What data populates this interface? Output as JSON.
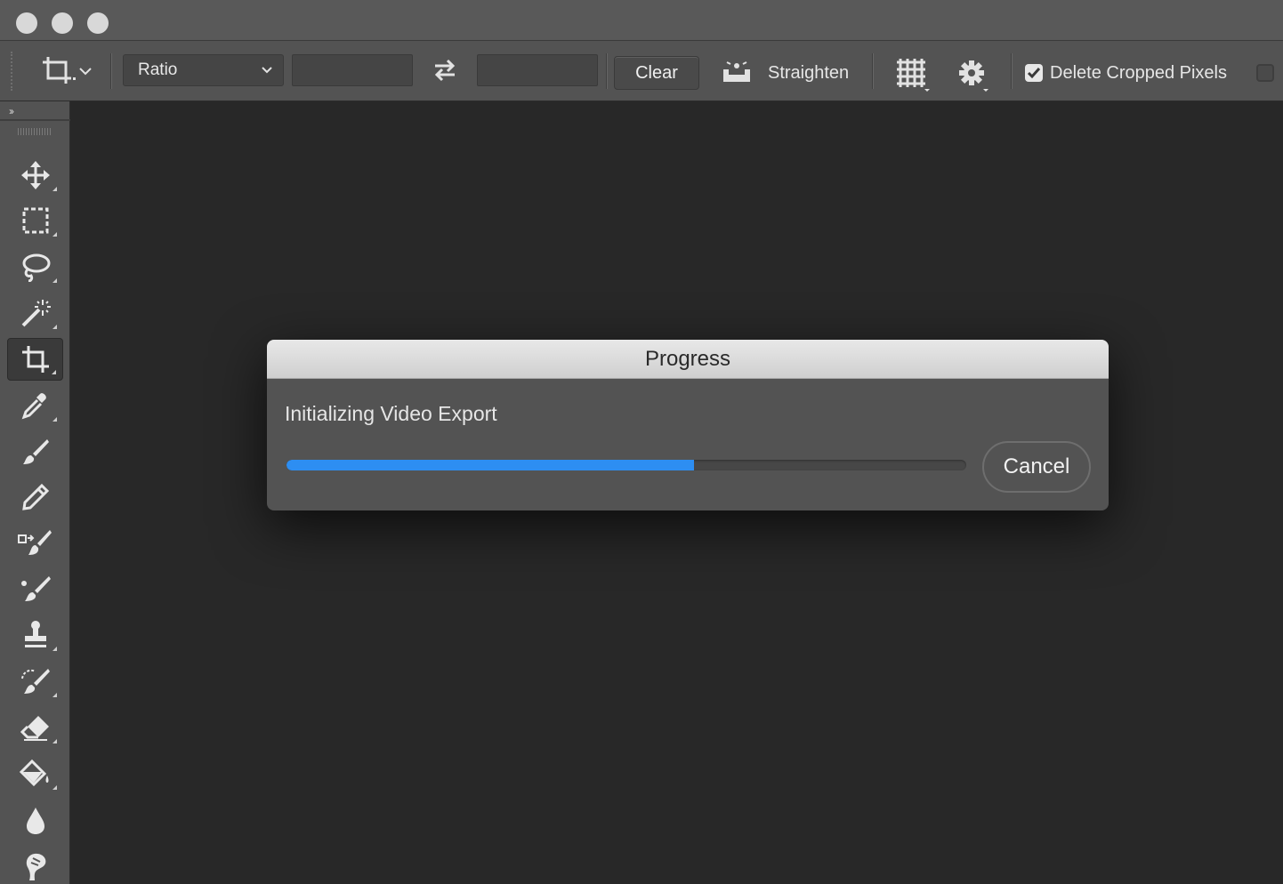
{
  "window": {
    "traffic_lights": [
      "close",
      "minimize",
      "zoom"
    ]
  },
  "options_bar": {
    "tool_icon": "crop-tool-icon",
    "ratio_select": {
      "selected": "Ratio"
    },
    "width_field": {
      "value": ""
    },
    "swap_icon": "swap-arrows-icon",
    "height_field": {
      "value": ""
    },
    "clear_label": "Clear",
    "straighten_label": "Straighten",
    "overlay_icon": "grid-overlay-icon",
    "settings_icon": "gear-icon",
    "delete_cropped": {
      "label": "Delete Cropped Pixels",
      "checked": true
    }
  },
  "toolbar": {
    "collapse_label": "››",
    "tools": [
      {
        "name": "move",
        "icon": "move-icon"
      },
      {
        "name": "marquee",
        "icon": "rectangular-marquee-icon"
      },
      {
        "name": "lasso",
        "icon": "lasso-icon"
      },
      {
        "name": "magic-wand",
        "icon": "magic-wand-icon"
      },
      {
        "name": "crop",
        "icon": "crop-icon",
        "active": true
      },
      {
        "name": "eyedropper",
        "icon": "eyedropper-icon"
      },
      {
        "name": "healing-brush",
        "icon": "healing-brush-icon"
      },
      {
        "name": "pencil",
        "icon": "pencil-icon"
      },
      {
        "name": "color-replacement",
        "icon": "color-replacement-icon"
      },
      {
        "name": "mixer-brush",
        "icon": "mixer-brush-icon"
      },
      {
        "name": "clone-stamp",
        "icon": "clone-stamp-icon"
      },
      {
        "name": "history-brush",
        "icon": "history-brush-icon"
      },
      {
        "name": "eraser",
        "icon": "eraser-icon"
      },
      {
        "name": "paint-bucket",
        "icon": "paint-bucket-icon"
      },
      {
        "name": "blur",
        "icon": "blur-drop-icon"
      },
      {
        "name": "smudge",
        "icon": "smudge-icon"
      }
    ]
  },
  "dialog": {
    "title": "Progress",
    "message": "Initializing Video Export",
    "progress_fraction": 0.6,
    "cancel_label": "Cancel"
  },
  "colors": {
    "accent": "#2d8ef2",
    "panel": "#535353",
    "canvas": "#282828"
  }
}
